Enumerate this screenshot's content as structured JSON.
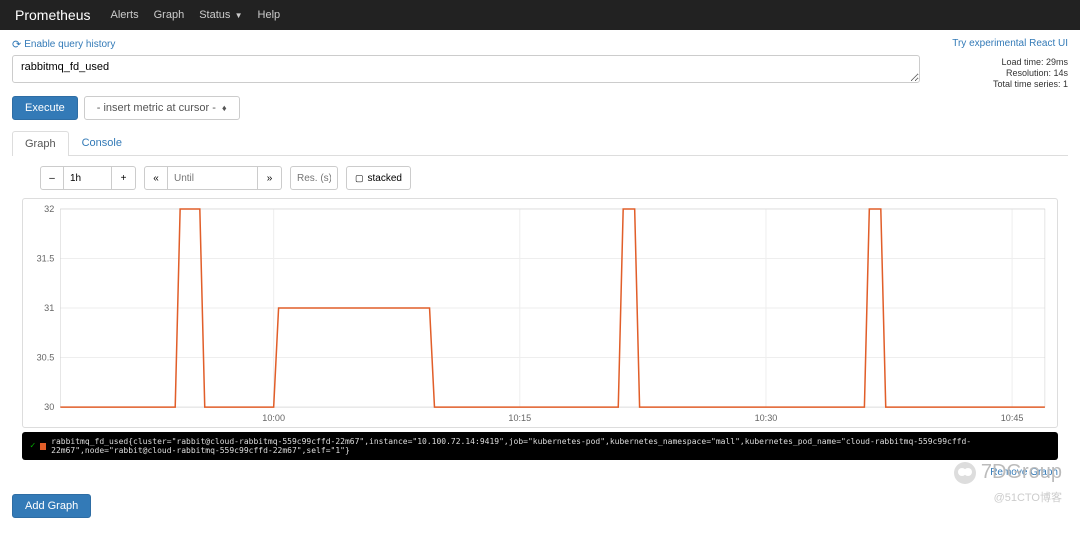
{
  "navbar": {
    "brand": "Prometheus",
    "items": [
      "Alerts",
      "Graph",
      "Status",
      "Help"
    ],
    "status_has_caret": true
  },
  "top_links": {
    "history": "Enable query history",
    "react_ui": "Try experimental React UI"
  },
  "side_info": {
    "load_time": "Load time: 29ms",
    "resolution": "Resolution: 14s",
    "series": "Total time series: 1"
  },
  "query": {
    "value": "rabbitmq_fd_used"
  },
  "execute": "Execute",
  "metric_dropdown": "- insert metric at cursor -",
  "tabs": {
    "graph": "Graph",
    "console": "Console"
  },
  "controls": {
    "minus": "–",
    "plus": "+",
    "range": "1h",
    "back": "«",
    "fwd": "»",
    "until_placeholder": "Until",
    "res_placeholder": "Res. (s)",
    "stacked": "stacked"
  },
  "legend": {
    "text": "rabbitmq_fd_used{cluster=\"rabbit@cloud-rabbitmq-559c99cffd-22m67\",instance=\"10.100.72.14:9419\",job=\"kubernetes-pod\",kubernetes_namespace=\"mall\",kubernetes_pod_name=\"cloud-rabbitmq-559c99cffd-22m67\",node=\"rabbit@cloud-rabbitmq-559c99cffd-22m67\",self=\"1\"}"
  },
  "remove_graph": "Remove Graph",
  "add_graph": "Add Graph",
  "watermark": {
    "top": "7DGroup",
    "sub": "@51CTO博客"
  },
  "chart_data": {
    "type": "line",
    "ylim": [
      30,
      32
    ],
    "yticks": [
      30,
      30.5,
      31,
      31.5,
      32
    ],
    "x_range_minutes": 60,
    "xticks": [
      {
        "t": 13,
        "label": "10:00"
      },
      {
        "t": 28,
        "label": "10:15"
      },
      {
        "t": 43,
        "label": "10:30"
      },
      {
        "t": 58,
        "label": "10:45"
      }
    ],
    "series": [
      {
        "name": "rabbitmq_fd_used",
        "color": "#e15e29",
        "points": [
          {
            "t": 0,
            "v": 30
          },
          {
            "t": 7,
            "v": 30
          },
          {
            "t": 7.3,
            "v": 32
          },
          {
            "t": 8.5,
            "v": 32
          },
          {
            "t": 8.8,
            "v": 30
          },
          {
            "t": 13,
            "v": 30
          },
          {
            "t": 13.3,
            "v": 31
          },
          {
            "t": 22.5,
            "v": 31
          },
          {
            "t": 22.8,
            "v": 30
          },
          {
            "t": 34,
            "v": 30
          },
          {
            "t": 34.3,
            "v": 32
          },
          {
            "t": 35,
            "v": 32
          },
          {
            "t": 35.3,
            "v": 30
          },
          {
            "t": 49,
            "v": 30
          },
          {
            "t": 49.3,
            "v": 32
          },
          {
            "t": 50,
            "v": 32
          },
          {
            "t": 50.3,
            "v": 30
          },
          {
            "t": 60,
            "v": 30
          }
        ]
      }
    ]
  }
}
